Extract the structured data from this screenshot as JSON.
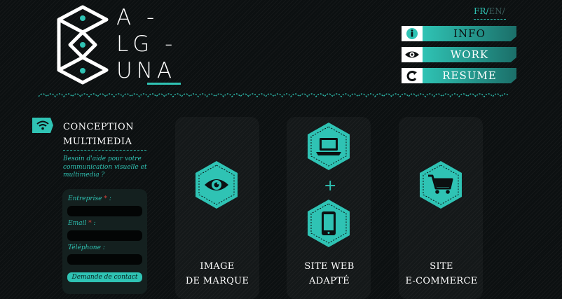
{
  "brand": {
    "logo_lines": [
      "A -",
      "LG -",
      "UNA"
    ]
  },
  "lang": {
    "fr": "FR/",
    "en": "EN/"
  },
  "nav": [
    {
      "label": "INFO",
      "icon": "info-icon"
    },
    {
      "label": "WORK",
      "icon": "eye-icon"
    },
    {
      "label": "RESUME",
      "icon": "refresh-icon"
    }
  ],
  "sidebar": {
    "title_line1": "CONCEPTION",
    "title_line2": "MULTIMEDIA",
    "desc": "Besoin d'aide pour votre communication visuelle et multimedia ?",
    "form": {
      "company_label": "Entreprise",
      "email_label": "Email",
      "phone_label": "Téléphone :",
      "required_mark": "*",
      "label_suffix": " :",
      "submit": "Demande de contact"
    }
  },
  "services": [
    {
      "line1": "IMAGE",
      "line2": "DE MARQUE",
      "icon": "eye-icon"
    },
    {
      "line1": "SITE WEB",
      "line2": "ADAPTÉ",
      "icon": "laptop-icon",
      "icon2": "tablet-icon",
      "plus": "+"
    },
    {
      "line1": "SITE",
      "line2": "E-COMMERCE",
      "icon": "cart-icon"
    }
  ],
  "colors": {
    "accent": "#2fc3b4",
    "background": "#0c1011",
    "required": "#e0443c"
  }
}
